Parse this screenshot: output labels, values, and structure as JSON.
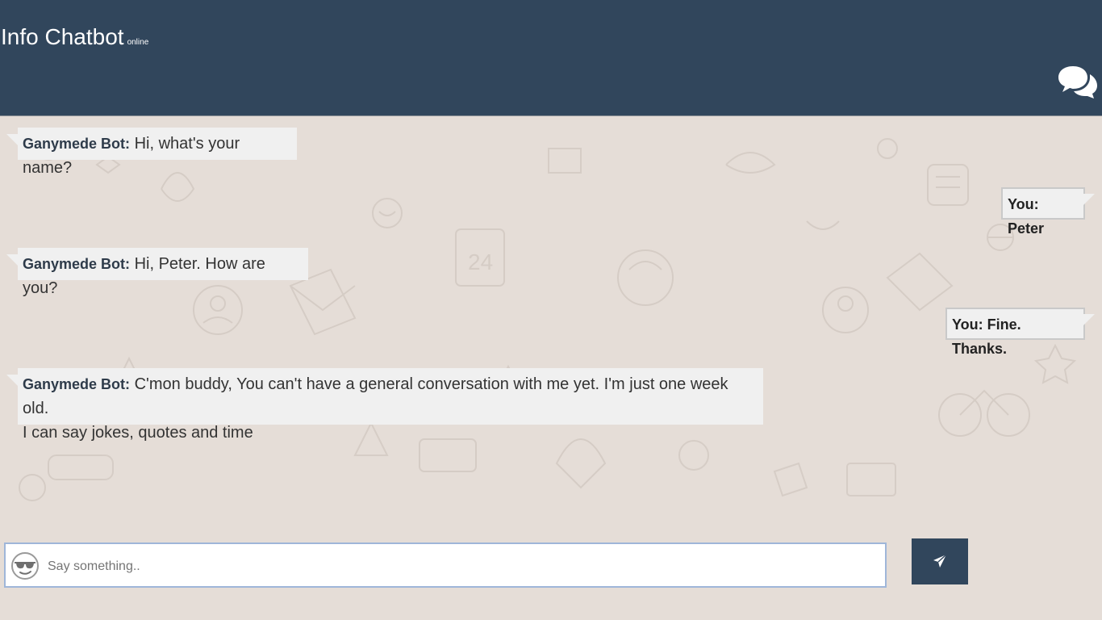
{
  "header": {
    "title": "Info Chatbot",
    "status": "online",
    "icon": "chat-bubbles-icon"
  },
  "messages": [
    {
      "from": "bot",
      "sender": "Ganymede Bot:",
      "text": "Hi, what's your name?"
    },
    {
      "from": "user",
      "text": "You: Peter"
    },
    {
      "from": "bot",
      "sender": "Ganymede Bot:",
      "text": "Hi, Peter. How are you?"
    },
    {
      "from": "user",
      "text": "You: Fine. Thanks."
    },
    {
      "from": "bot",
      "sender": "Ganymede Bot:",
      "text": "C'mon buddy, You can't have a general conversation with me yet. I'm just one week old.",
      "text2": "I can say jokes, quotes and time"
    }
  ],
  "composer": {
    "placeholder": "Say something..",
    "emoji_icon": "sunglasses-emoji-icon",
    "send_icon": "paper-plane-icon"
  },
  "colors": {
    "header_bg": "#31465c",
    "chat_bg": "#e5ddd7",
    "bubble_bg": "#f0f0f0",
    "send_button_bg": "#31465c"
  }
}
